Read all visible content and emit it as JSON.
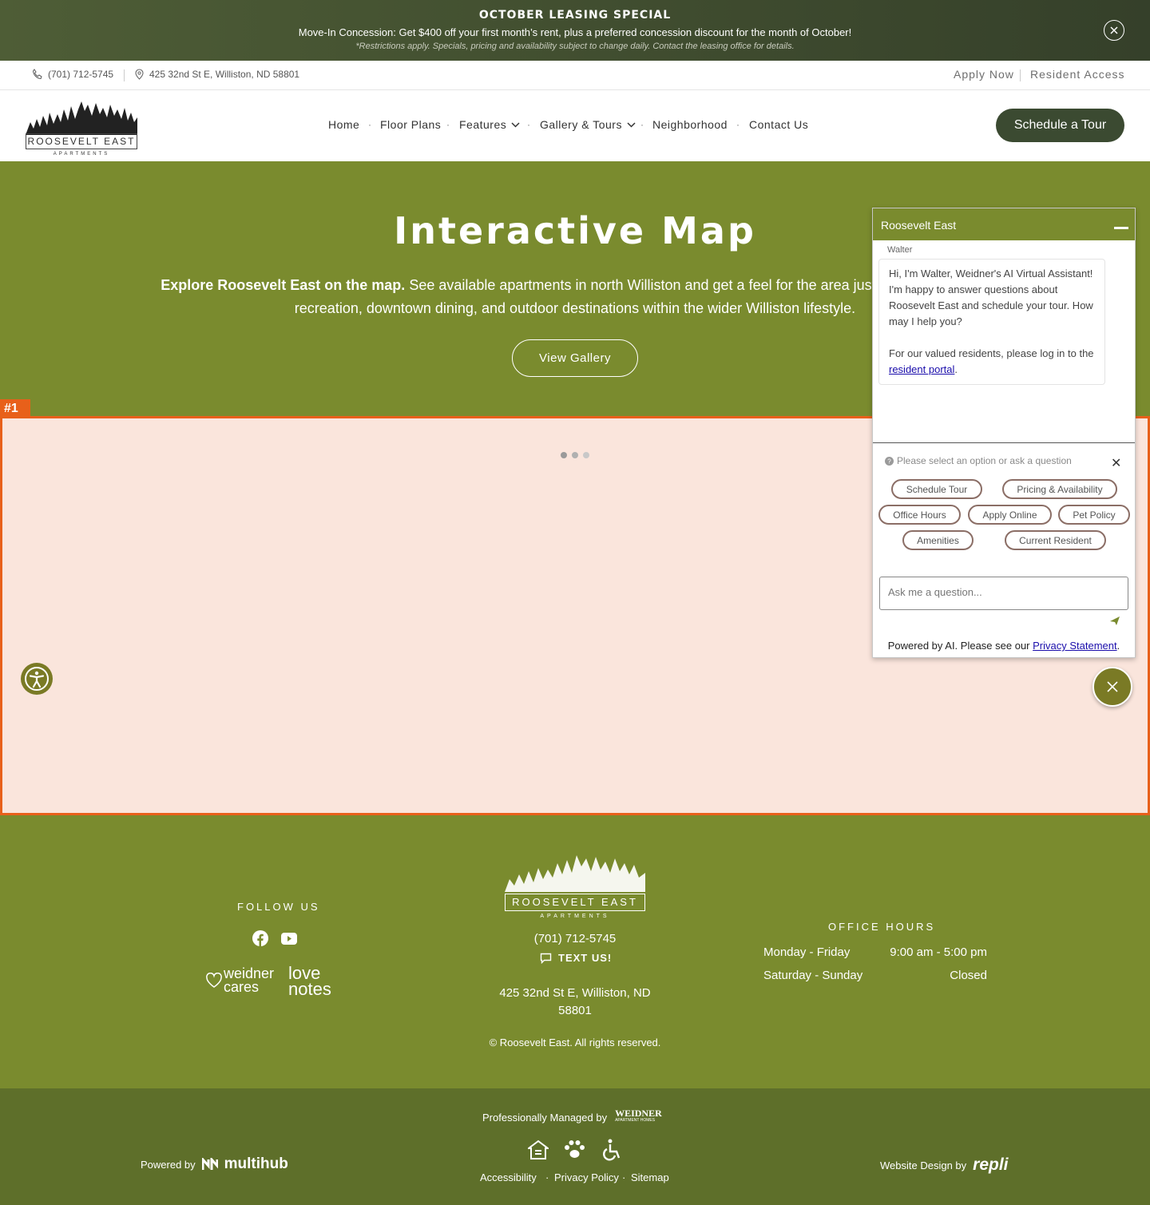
{
  "promo": {
    "title": "OCTOBER LEASING SPECIAL",
    "description": "Move-In Concession: Get $400 off your first month’s rent, plus a preferred concession discount for the month of October!",
    "restrictions": "*Restrictions apply. Specials, pricing and availability subject to change daily. Contact the leasing office for details."
  },
  "utility": {
    "phone": "(701) 712-5745",
    "address": "425 32nd St E, Williston, ND 58801",
    "apply": "Apply Now",
    "resident": "Resident Access"
  },
  "header": {
    "logo_text": "ROOSEVELT EAST",
    "logo_sub": "APARTMENTS",
    "nav": {
      "home": "Home",
      "floor_plans": "Floor Plans",
      "features": "Features",
      "gallery_tours": "Gallery & Tours",
      "neighborhood": "Neighborhood",
      "contact": "Contact Us"
    },
    "cta": "Schedule a Tour"
  },
  "hero": {
    "title": "Interactive Map",
    "lead": "Explore Roosevelt East on the map.",
    "text": "See available apartments in north Williston and get a feel for the area just east of shopping, recreation, downtown dining, and outdoor destinations within the wider Williston lifestyle.",
    "button": "View Gallery"
  },
  "map": {
    "tag": "#1"
  },
  "chat": {
    "title": "Roosevelt East",
    "agent": "Walter",
    "message_1": "Hi, I'm Walter, Weidner's AI Virtual Assistant! I'm happy to answer questions about Roosevelt East and schedule your tour. How may I help you?",
    "message_2": "For our valued residents, please log in to the",
    "portal_link": "resident portal",
    "prompt": "Please select an option or ask a question",
    "options": {
      "schedule": "Schedule Tour",
      "pricing": "Pricing & Availability",
      "hours": "Office Hours",
      "apply": "Apply Online",
      "pet": "Pet Policy",
      "amenities": "Amenities",
      "resident": "Current Resident"
    },
    "input_placeholder": "Ask me a question...",
    "powered": "Powered by AI. Please see our",
    "privacy": "Privacy Statement"
  },
  "footer": {
    "follow": "FOLLOW US",
    "weidner_cares": "weidner cares",
    "love_notes": "love notes",
    "logo_text": "ROOSEVELT EAST",
    "logo_sub": "APARTMENTS",
    "phone": "(701) 712-5745",
    "text_us": "TEXT US!",
    "address_1": "425 32nd St E, Williston, ND",
    "address_2": "58801",
    "copyright": "© Roosevelt East. All rights reserved.",
    "hours_title": "OFFICE HOURS",
    "hours": [
      {
        "days": "Monday - Friday",
        "time": "9:00 am - 5:00 pm"
      },
      {
        "days": "Saturday - Sunday",
        "time": "Closed"
      }
    ]
  },
  "bottom": {
    "managed": "Professionally Managed by",
    "weidner": "WEIDNER",
    "weidner_sub": "APARTMENT HOMES",
    "powered": "Powered by",
    "multihub": "multihub",
    "design": "Website Design by",
    "repli": "repli",
    "accessibility": "Accessibility",
    "privacy": "Privacy Policy",
    "sitemap": "Sitemap"
  },
  "colors": {
    "brand_green": "#7a8b2e",
    "dark_green": "#3b4a31",
    "highlight": "#e8601a"
  }
}
